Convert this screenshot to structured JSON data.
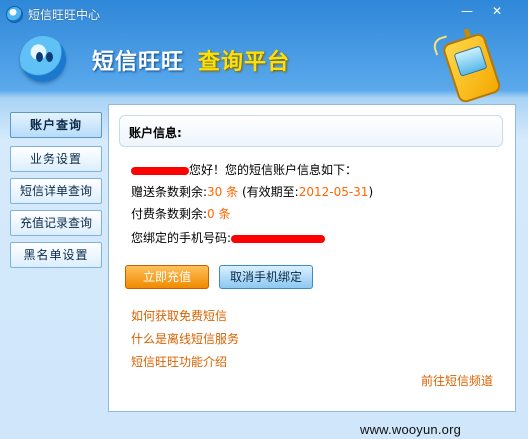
{
  "window": {
    "title": "短信旺旺中心",
    "min_glyph": "—",
    "close_glyph": "✕"
  },
  "header": {
    "brand": "短信旺旺",
    "subtitle": "查询平台"
  },
  "sidebar": {
    "items": [
      {
        "label": "账户查询",
        "active": true
      },
      {
        "label": "业务设置",
        "active": false
      },
      {
        "label": "短信详单查询",
        "active": false
      },
      {
        "label": "充值记录查询",
        "active": false
      },
      {
        "label": "黑名单设置",
        "active": false
      }
    ]
  },
  "account": {
    "section_title": "账户信息:",
    "greeting": "您好！您的短信账户信息如下：",
    "gift_label": "赠送条数剩余:",
    "gift_value": "30 条",
    "valid_prefix": "(有效期至:",
    "valid_date": "2012-05-31",
    "valid_suffix": ")",
    "paid_label": "付费条数剩余:",
    "paid_value": "0 条",
    "phone_label": "您绑定的手机号码:"
  },
  "actions": {
    "recharge": "立即充值",
    "unbind": "取消手机绑定"
  },
  "links": {
    "free_sms": "如何获取免费短信",
    "offline_service": "什么是离线短信服务",
    "features": "短信旺旺功能介绍",
    "channel": "前往短信频道"
  },
  "watermark": "www.wooyun.org",
  "colors": {
    "accent_orange": "#ff6600",
    "link_orange": "#d86200",
    "redaction": "#ff0000",
    "brand_blue": "#2f87d8"
  }
}
